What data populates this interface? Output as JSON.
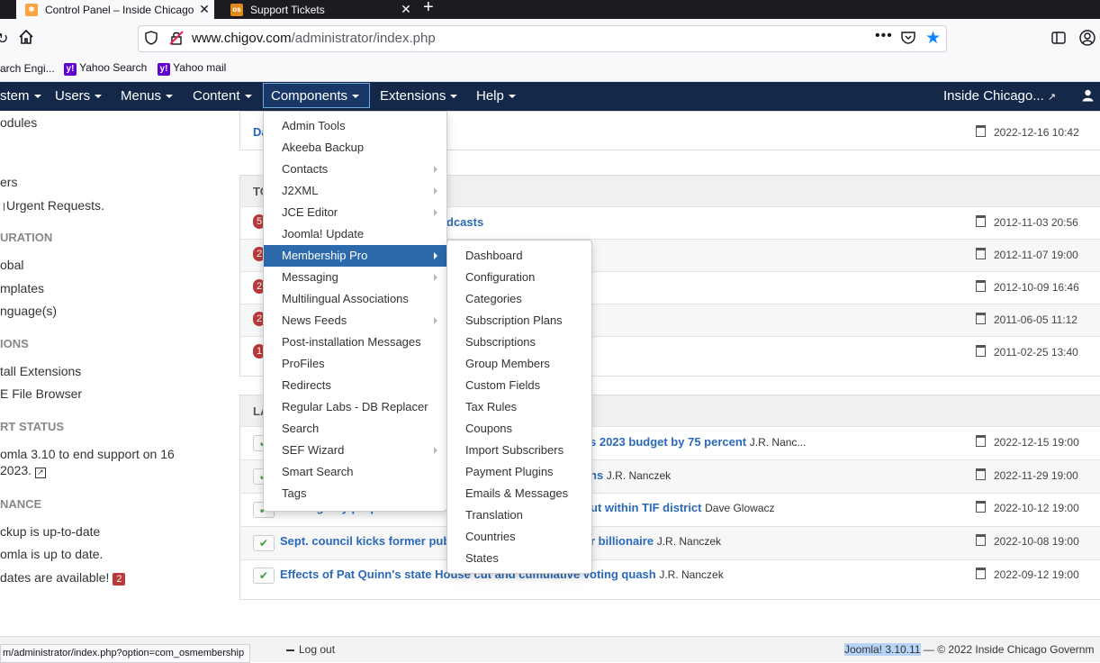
{
  "browser": {
    "tabs": [
      {
        "title": "Control Panel – Inside Chicago",
        "active": true
      },
      {
        "title": "Support Tickets",
        "active": false
      }
    ],
    "url_domain": "www.chigov.com",
    "url_path": "/administrator/index.php",
    "bookmarks": [
      "arch Engi...",
      "Yahoo Search",
      "Yahoo mail"
    ],
    "status_url": "m/administrator/index.php?option=com_osmembership"
  },
  "topnav": {
    "items": [
      {
        "label": "stem"
      },
      {
        "label": "Users"
      },
      {
        "label": "Menus"
      },
      {
        "label": "Content"
      },
      {
        "label": "Components"
      },
      {
        "label": "Extensions"
      },
      {
        "label": "Help"
      }
    ],
    "site_name": "Inside Chicago..."
  },
  "sidebar": {
    "modules": "odules",
    "users": "ers",
    "urgent": "Urgent Requests.",
    "config_heading": "URATION",
    "global": "obal",
    "templates": "mplates",
    "languages": "nguage(s)",
    "extensions_heading": "IONS",
    "install": "tall Extensions",
    "file_browser": "E File Browser",
    "support_heading": "RT STATUS",
    "support_line1": "omla 3.10 to end support on 16",
    "support_line2": "2023.",
    "maintenance_heading": "NANCE",
    "backup": "ckup is up-to-date",
    "uptodate": "omla is up to date.",
    "updates": "dates are available!",
    "updates_count": "2"
  },
  "panels": {
    "top_row": {
      "label": "Da",
      "date": "2022-12-16 10:42"
    },
    "popular_heading": "TO",
    "popular": [
      {
        "badge": "5",
        "title": "dcasts",
        "date": "2012-11-03 20:56"
      },
      {
        "badge": "2",
        "title": "",
        "date": "2012-11-07 19:00"
      },
      {
        "badge": "2",
        "title": "",
        "date": "2012-10-09 16:46"
      },
      {
        "badge": "2",
        "title": "",
        "date": "2011-06-05 11:12"
      },
      {
        "badge": "1",
        "title": "",
        "date": "2011-02-25 13:40"
      }
    ],
    "latest_heading": "LA",
    "latest": [
      {
        "title": "s 2023 budget by 75 percent",
        "author": "J.R. Nanc...",
        "date": "2022-12-15 19:00"
      },
      {
        "title": "ns",
        "author": "J.R. Nanczek",
        "date": "2022-11-29 19:00"
      },
      {
        "title": "Sterling Bay proposes tower",
        "title2": "ut within TIF district",
        "author": "Dave Glowacz",
        "date": "2022-10-12 19:00"
      },
      {
        "title": "Sept. council kicks former pub",
        "title2": "r billionaire",
        "author": "J.R. Nanczek",
        "date": "2022-10-08 19:00"
      },
      {
        "title": "Effects of Pat Quinn's state House cut and cumulative voting quash",
        "author": "J.R. Nanczek",
        "date": "2022-09-12 19:00"
      }
    ]
  },
  "components_menu": {
    "items": [
      {
        "label": "Admin Tools",
        "sub": false
      },
      {
        "label": "Akeeba Backup",
        "sub": false
      },
      {
        "label": "Contacts",
        "sub": true
      },
      {
        "label": "J2XML",
        "sub": true
      },
      {
        "label": "JCE Editor",
        "sub": true
      },
      {
        "label": "Joomla! Update",
        "sub": false
      },
      {
        "label": "Membership Pro",
        "sub": true,
        "active": true
      },
      {
        "label": "Messaging",
        "sub": true
      },
      {
        "label": "Multilingual Associations",
        "sub": false
      },
      {
        "label": "News Feeds",
        "sub": true
      },
      {
        "label": "Post-installation Messages",
        "sub": false
      },
      {
        "label": "ProFiles",
        "sub": false
      },
      {
        "label": "Redirects",
        "sub": false
      },
      {
        "label": "Regular Labs - DB Replacer",
        "sub": false
      },
      {
        "label": "Search",
        "sub": false
      },
      {
        "label": "SEF Wizard",
        "sub": true
      },
      {
        "label": "Smart Search",
        "sub": false
      },
      {
        "label": "Tags",
        "sub": false
      }
    ]
  },
  "membership_menu": {
    "items": [
      "Dashboard",
      "Configuration",
      "Categories",
      "Subscription Plans",
      "Subscriptions",
      "Group Members",
      "Custom Fields",
      "Tax Rules",
      "Coupons",
      "Import Subscribers",
      "Payment Plugins",
      "Emails & Messages",
      "Translation",
      "Countries",
      "States"
    ]
  },
  "footer": {
    "logout": "Log out",
    "version": "Joomla! 3.10.11",
    "dash": "—",
    "copyright": "© 2022 Inside Chicago Governm"
  },
  "colors": {
    "nav_bg": "#142849",
    "active_item": "#2d6aab",
    "link": "#2a69b8",
    "badge": "#b83a3a"
  }
}
